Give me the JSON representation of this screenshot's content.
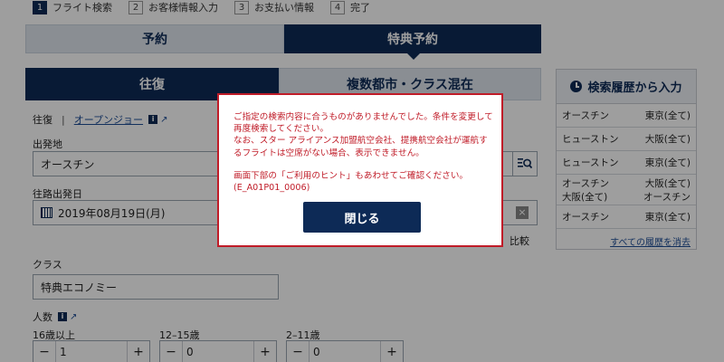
{
  "steps": [
    {
      "num": "1",
      "label": "フライト検索"
    },
    {
      "num": "2",
      "label": "お客様情報入力"
    },
    {
      "num": "3",
      "label": "お支払い情報"
    },
    {
      "num": "4",
      "label": "完了"
    }
  ],
  "main_tabs": {
    "reserve": "予約",
    "award": "特典予約"
  },
  "trip_tabs": {
    "roundtrip": "往復",
    "multi": "複数都市・クラス混在"
  },
  "trip_type": {
    "roundtrip": "往復",
    "open_jaw": "オープンジョー"
  },
  "origin": {
    "label": "出発地",
    "value": "オースチン"
  },
  "depart_date": {
    "label": "往路出発日",
    "value": "2019年08月19日(月)"
  },
  "compare_text": "比較",
  "cabin": {
    "label": "クラス",
    "value": "特典エコノミー"
  },
  "pax": {
    "label": "人数",
    "adult": {
      "label": "16歳以上",
      "value": "1"
    },
    "youth": {
      "label": "12–15歳",
      "value": "0"
    },
    "child": {
      "label": "2–11歳",
      "value": "0"
    }
  },
  "history": {
    "title": "検索履歴から入力",
    "rows": [
      {
        "from": "オースチン",
        "to": "東京(全て)"
      },
      {
        "from": "ヒューストン",
        "to": "大阪(全て)"
      },
      {
        "from": "ヒューストン",
        "to": "東京(全て)"
      },
      {
        "from": "オースチン",
        "to": "大阪(全て)",
        "from2": "大阪(全て)",
        "to2": "オースチン"
      },
      {
        "from": "オースチン",
        "to": "東京(全て)"
      }
    ],
    "clear_link": "すべての履歴を消去"
  },
  "modal": {
    "line1": "ご指定の検索内容に合うものがありませんでした。条件を変更して再度検索してください。",
    "line2": "なお、スター アライアンス加盟航空会社、提携航空会社が運航するフライトは空席がない場合、表示できません。",
    "line3": "画面下部の「ご利用のヒント」もあわせてご確認ください。",
    "code": "(E_A01P01_0006)",
    "close_label": "閉じる"
  },
  "colors": {
    "navy": "#0d2a56",
    "error_red": "#c01c28",
    "light_tab": "#dfe6ee"
  }
}
